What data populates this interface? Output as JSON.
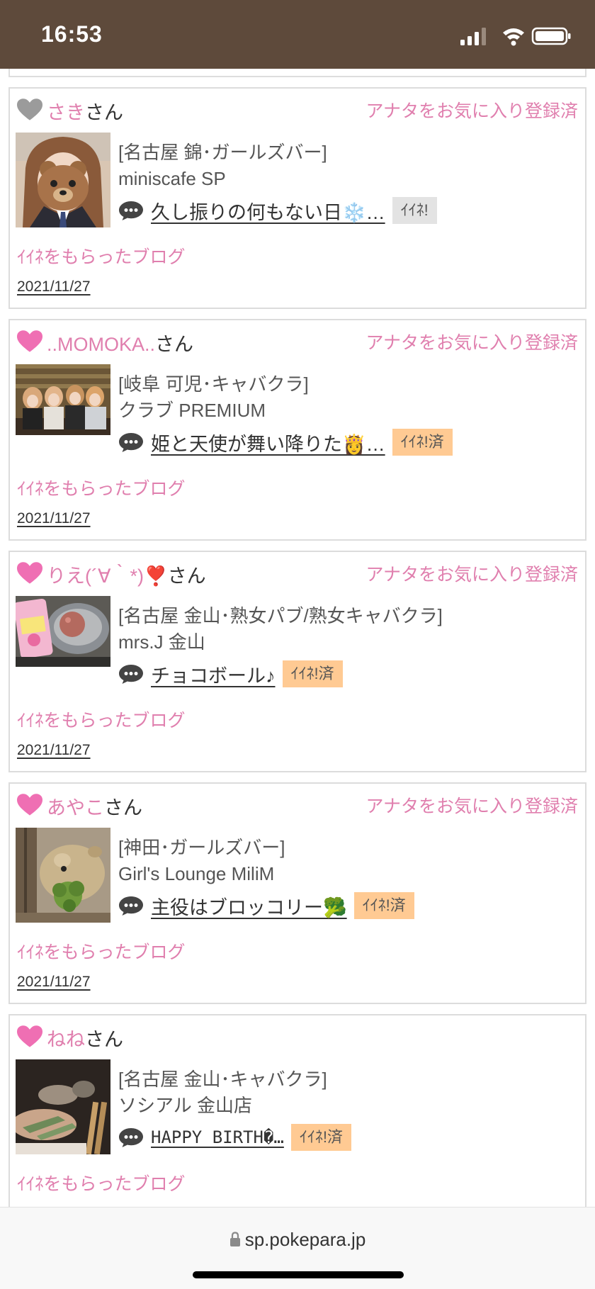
{
  "status_bar": {
    "time": "16:53"
  },
  "colors": {
    "accent_pink": "#e07fae",
    "status_bar_bg": "#5e4a3b",
    "iine_done_bg": "#ffca93",
    "iine_undone_bg": "#e3e3e3"
  },
  "cards": [
    {
      "name": "さき",
      "suffix": "さん",
      "heart": "gray-heart-icon",
      "fav_status": "アナタをお気に入り登録済",
      "shop_area": "[名古屋 錦･ガールズバー]",
      "shop_name": "miniscafe SP",
      "blog_title": "久し振りの何もない日❄️…",
      "iine_label": "ｲｲﾈ!",
      "iine_done": false,
      "received_label": "ｲｲﾈをもらったブログ",
      "date": "2021/11/27"
    },
    {
      "name": "..MOMOKA..",
      "suffix": "さん",
      "heart": "pink-heart-icon",
      "fav_status": "アナタをお気に入り登録済",
      "shop_area": "[岐阜 可児･キャバクラ]",
      "shop_name": "クラブ PREMIUM",
      "blog_title": "姫と天使が舞い降りた👸…",
      "iine_label": "ｲｲﾈ!済",
      "iine_done": true,
      "received_label": "ｲｲﾈをもらったブログ",
      "date": "2021/11/27"
    },
    {
      "name": "りえ(´∀｀*)❣️",
      "suffix": "さん",
      "heart": "pink-heart-icon",
      "fav_status": "アナタをお気に入り登録済",
      "shop_area": "[名古屋 金山･熟女パブ/熟女キャバクラ]",
      "shop_name": "mrs.J 金山",
      "blog_title": "チョコボール♪",
      "iine_label": "ｲｲﾈ!済",
      "iine_done": true,
      "received_label": "ｲｲﾈをもらったブログ",
      "date": "2021/11/27"
    },
    {
      "name": "あやこ",
      "suffix": "さん",
      "heart": "pink-heart-icon",
      "fav_status": "アナタをお気に入り登録済",
      "shop_area": "[神田･ガールズバー]",
      "shop_name": "Girl's Lounge MiliM",
      "blog_title": "主役はブロッコリー🥦",
      "iine_label": "ｲｲﾈ!済",
      "iine_done": true,
      "received_label": "ｲｲﾈをもらったブログ",
      "date": "2021/11/27"
    },
    {
      "name": "ねね",
      "suffix": "さん",
      "heart": "pink-heart-icon",
      "fav_status": "",
      "shop_area": "[名古屋 金山･キャバクラ]",
      "shop_name": "ソシアル 金山店",
      "blog_title": "HAPPY BIRTH�…",
      "iine_label": "ｲｲﾈ!済",
      "iine_done": true,
      "received_label": "ｲｲﾈをもらったブログ",
      "date": ""
    }
  ],
  "browser": {
    "url": "sp.pokepara.jp"
  }
}
